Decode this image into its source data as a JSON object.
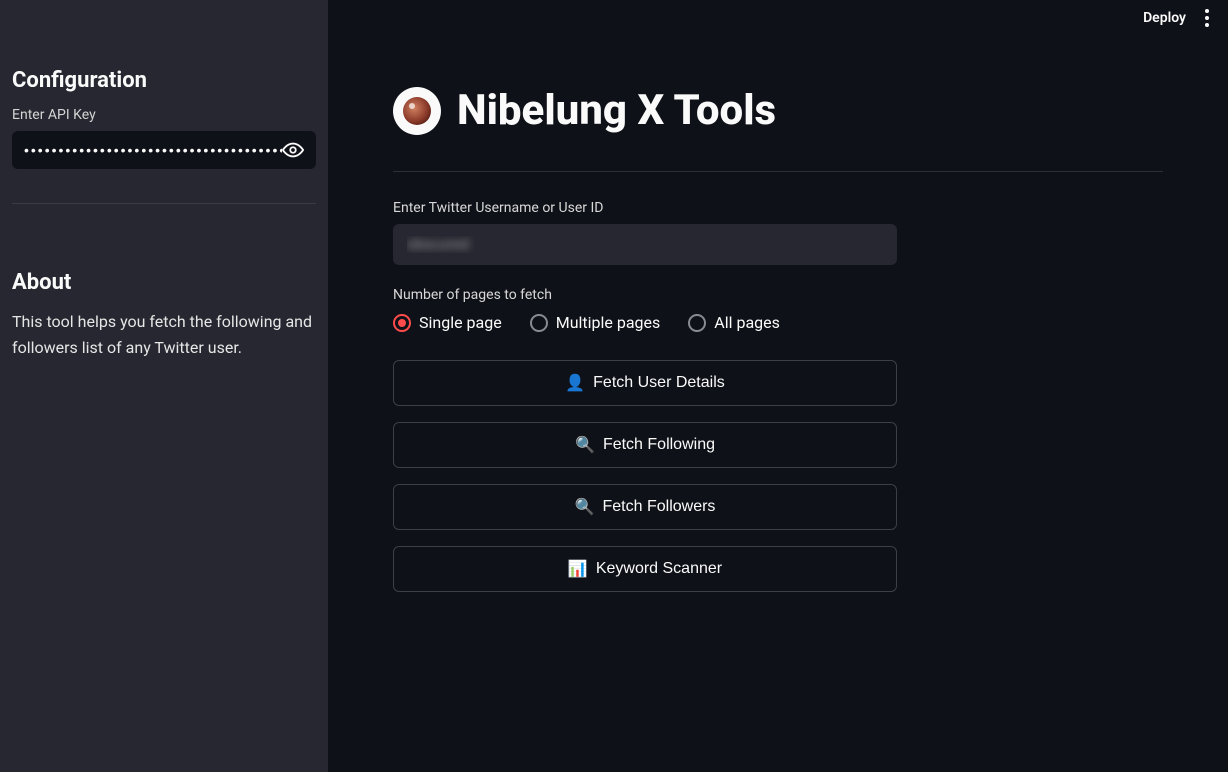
{
  "topbar": {
    "deploy_label": "Deploy"
  },
  "sidebar": {
    "config_heading": "Configuration",
    "api_key_label": "Enter API Key",
    "api_key_value": "••••••••••••••••••••••••••••••••••••••••",
    "about_heading": "About",
    "about_text": "This tool helps you fetch the following and followers list of any Twitter user."
  },
  "main": {
    "title": "Nibelung X Tools",
    "username_label": "Enter Twitter Username or User ID",
    "username_value": "obscured",
    "pages_label": "Number of pages to fetch",
    "radio_options": [
      {
        "label": "Single page",
        "selected": true
      },
      {
        "label": "Multiple pages",
        "selected": false
      },
      {
        "label": "All pages",
        "selected": false
      }
    ],
    "buttons": {
      "user_details": "Fetch User Details",
      "following": "Fetch Following",
      "followers": "Fetch Followers",
      "keyword_scanner": "Keyword Scanner"
    },
    "button_icons": {
      "user_details": "👤",
      "following": "🔍",
      "followers": "🔍",
      "keyword_scanner": "📊"
    }
  }
}
